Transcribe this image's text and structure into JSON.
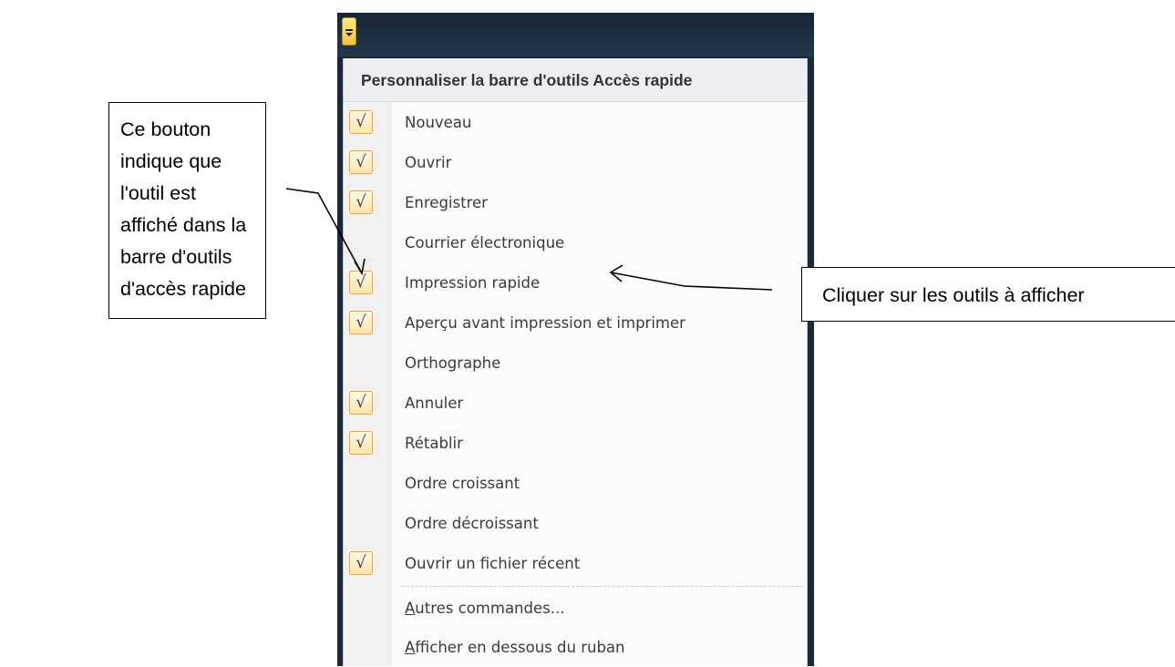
{
  "window": {
    "qat_button_icon": "customize-qat-dropdown-icon"
  },
  "menu": {
    "title": "Personnaliser la barre d'outils Accès rapide",
    "items": [
      {
        "label": "Nouveau",
        "checked": true
      },
      {
        "label": "Ouvrir",
        "checked": true
      },
      {
        "label": "Enregistrer",
        "checked": true
      },
      {
        "label": "Courrier électronique",
        "checked": false
      },
      {
        "label": "Impression rapide",
        "checked": true
      },
      {
        "label": "Aperçu avant impression et imprimer",
        "checked": true
      },
      {
        "label": "Orthographe",
        "checked": false
      },
      {
        "label": "Annuler",
        "checked": true
      },
      {
        "label": "Rétablir",
        "checked": true
      },
      {
        "label": "Ordre croissant",
        "checked": false
      },
      {
        "label": "Ordre décroissant",
        "checked": false
      },
      {
        "label": "Ouvrir un fichier récent",
        "checked": true
      }
    ],
    "more_commands": {
      "mnemonic": "A",
      "rest": "utres commandes..."
    },
    "show_below_ribbon": {
      "mnemonic": "A",
      "rest": "fficher en dessous du ruban"
    },
    "check_glyph": "√"
  },
  "callouts": {
    "left": "Ce bouton indique que l'outil est affiché dans la barre d'outils d'accès rapide",
    "right": "Cliquer sur les outils à afficher"
  },
  "colors": {
    "check_border": "#f2a33a",
    "frame": "#1b2a3a",
    "qat_button": "#f5c33b"
  }
}
